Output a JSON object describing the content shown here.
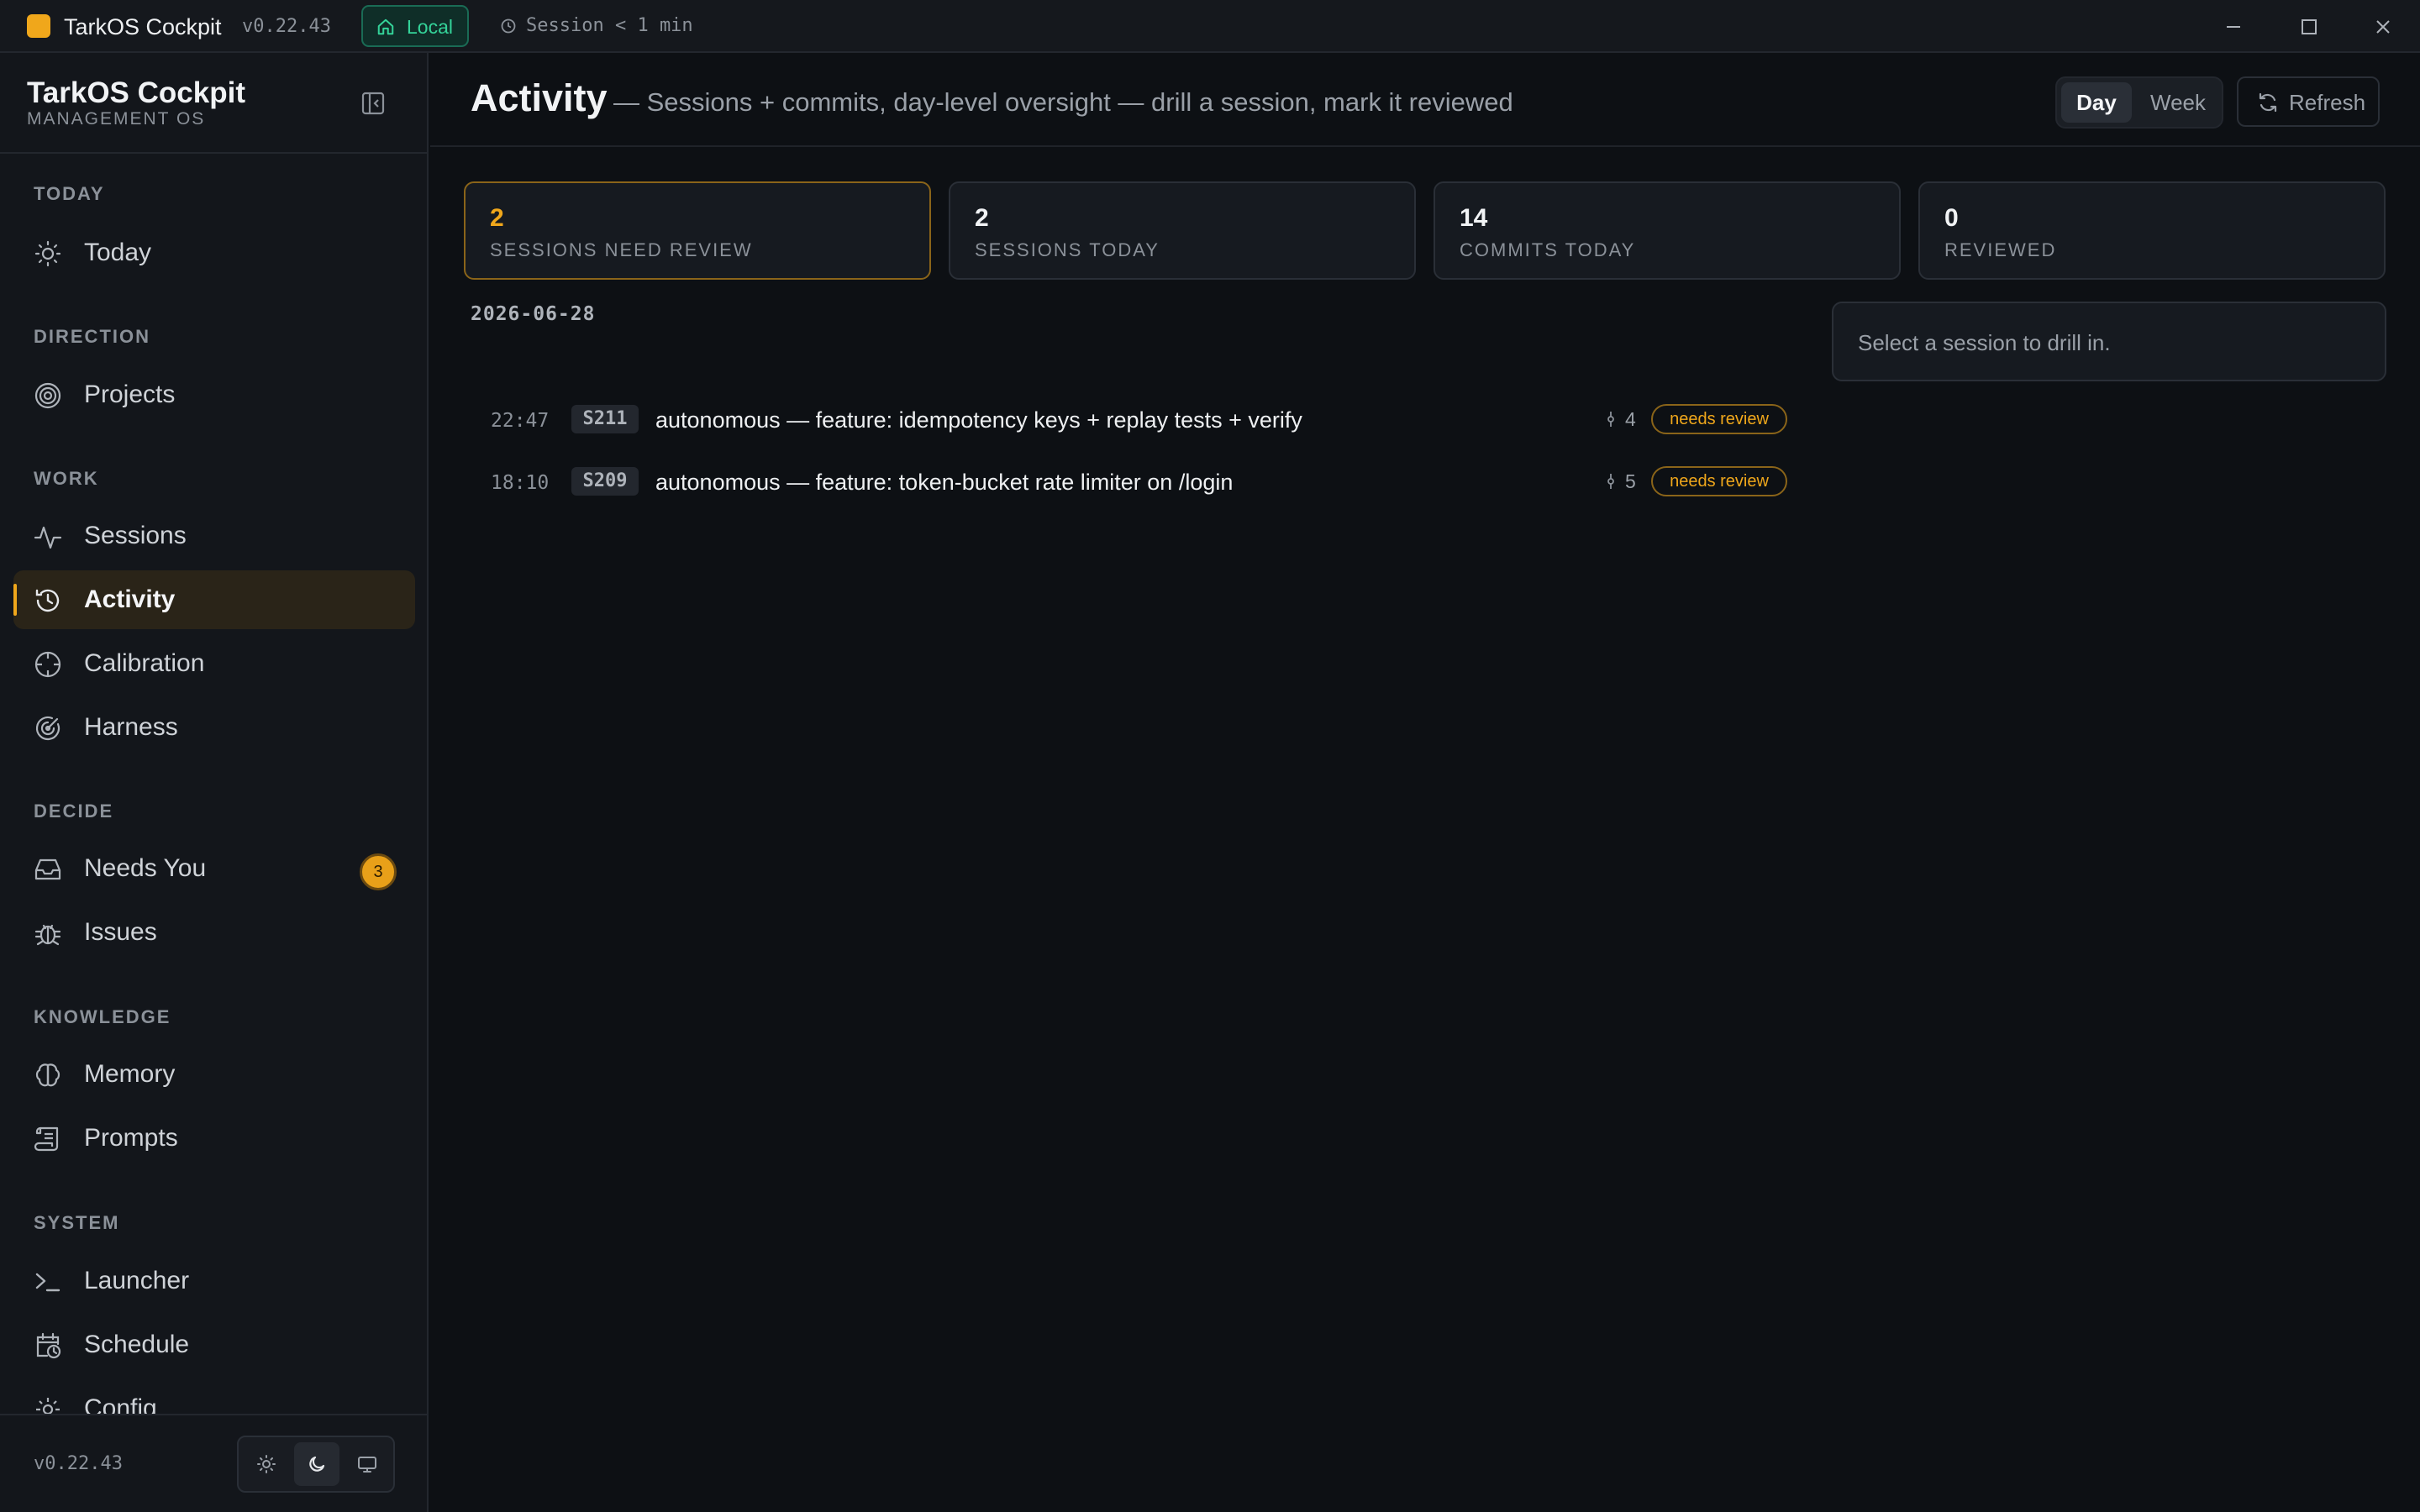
{
  "titlebar": {
    "app_name": "TarkOS Cockpit",
    "version": "v0.22.43",
    "env_label": "Local",
    "session_status": "Session < 1 min",
    "window_controls": [
      "minimize-icon",
      "maximize-icon",
      "close-icon"
    ]
  },
  "sidebar": {
    "brand_title": "TarkOS Cockpit",
    "brand_subtitle": "MANAGEMENT OS",
    "sections": [
      {
        "label": "TODAY",
        "items": [
          {
            "label": "Today",
            "icon": "sun-icon"
          }
        ]
      },
      {
        "label": "DIRECTION",
        "items": [
          {
            "label": "Projects",
            "icon": "target-icon"
          }
        ]
      },
      {
        "label": "WORK",
        "items": [
          {
            "label": "Sessions",
            "icon": "pulse-icon"
          },
          {
            "label": "Activity",
            "icon": "history-icon",
            "active": true
          },
          {
            "label": "Calibration",
            "icon": "crosshair-icon"
          },
          {
            "label": "Harness",
            "icon": "radar-icon"
          }
        ]
      },
      {
        "label": "DECIDE",
        "items": [
          {
            "label": "Needs You",
            "icon": "inbox-icon",
            "badge": "3"
          },
          {
            "label": "Issues",
            "icon": "bug-icon"
          }
        ]
      },
      {
        "label": "KNOWLEDGE",
        "items": [
          {
            "label": "Memory",
            "icon": "brain-icon"
          },
          {
            "label": "Prompts",
            "icon": "scroll-icon"
          }
        ]
      },
      {
        "label": "SYSTEM",
        "items": [
          {
            "label": "Launcher",
            "icon": "terminal-icon"
          },
          {
            "label": "Schedule",
            "icon": "calendar-clock-icon"
          },
          {
            "label": "Config",
            "icon": "gear-icon"
          }
        ]
      }
    ],
    "footer_version": "v0.22.43",
    "theme_options": [
      "light",
      "dark",
      "system"
    ],
    "theme_selected": "dark"
  },
  "header": {
    "title": "Activity",
    "subtitle": "— Sessions + commits, day-level oversight — drill a session, mark it reviewed",
    "range_options": [
      "Day",
      "Week"
    ],
    "range_selected": "Day",
    "refresh_label": "Refresh"
  },
  "stats": [
    {
      "value": "2",
      "label": "SESSIONS NEED REVIEW",
      "highlight": true
    },
    {
      "value": "2",
      "label": "SESSIONS TODAY"
    },
    {
      "value": "14",
      "label": "COMMITS TODAY"
    },
    {
      "value": "0",
      "label": "REVIEWED"
    }
  ],
  "activity": {
    "date": "2026-06-28",
    "rows": [
      {
        "time": "22:47",
        "id": "S211",
        "title": "autonomous — feature: idempotency keys + replay tests + verify",
        "commits": "4",
        "status": "needs review"
      },
      {
        "time": "18:10",
        "id": "S209",
        "title": "autonomous — feature: token-bucket rate limiter on /login",
        "commits": "5",
        "status": "needs review"
      }
    ]
  },
  "drill_panel": {
    "placeholder": "Select a session to drill in."
  },
  "colors": {
    "accent": "#f0a71b",
    "local_green": "#34d399",
    "background": "#0d1014"
  }
}
